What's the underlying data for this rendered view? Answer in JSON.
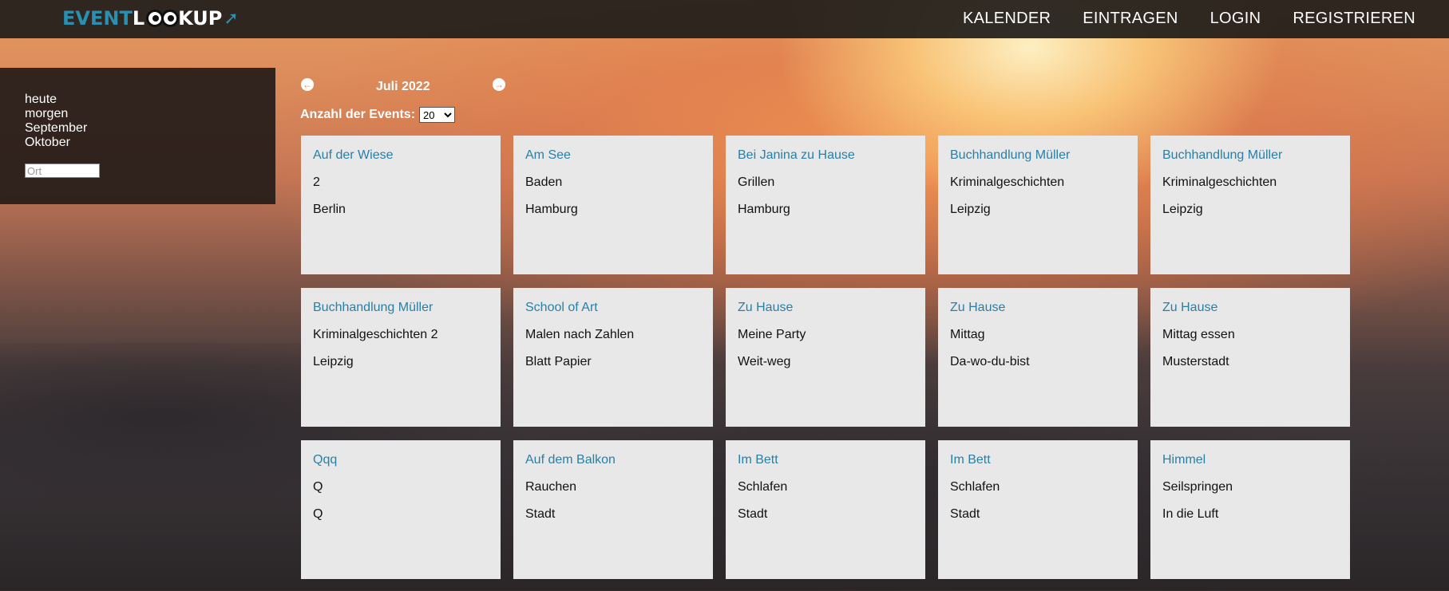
{
  "header": {
    "logo_text": "EVENTLOOKUP",
    "nav": [
      "KALENDER",
      "EINTRAGEN",
      "LOGIN",
      "REGISTRIEREN"
    ]
  },
  "sidebar": {
    "links": [
      "heute",
      "morgen",
      "September",
      "Oktober"
    ],
    "ort_placeholder": "Ort"
  },
  "calendar": {
    "month": "Juli 2022",
    "count_label": "Anzahl der Events:",
    "count_value": "20"
  },
  "events": [
    {
      "place": "Auf der Wiese",
      "title": "2",
      "city": "Berlin"
    },
    {
      "place": "Am See",
      "title": "Baden",
      "city": "Hamburg"
    },
    {
      "place": "Bei Janina zu Hause",
      "title": "Grillen",
      "city": "Hamburg"
    },
    {
      "place": "Buchhandlung Müller",
      "title": "Kriminalgeschichten",
      "city": "Leipzig"
    },
    {
      "place": "Buchhandlung Müller",
      "title": "Kriminalgeschichten",
      "city": "Leipzig"
    },
    {
      "place": "Buchhandlung Müller",
      "title": "Kriminalgeschichten 2",
      "city": "Leipzig"
    },
    {
      "place": "School of Art",
      "title": "Malen nach Zahlen",
      "city": "Blatt Papier"
    },
    {
      "place": "Zu Hause",
      "title": "Meine Party",
      "city": "Weit-weg"
    },
    {
      "place": "Zu Hause",
      "title": "Mittag",
      "city": "Da-wo-du-bist"
    },
    {
      "place": "Zu Hause",
      "title": "Mittag essen",
      "city": "Musterstadt"
    },
    {
      "place": "Qqq",
      "title": "Q",
      "city": "Q"
    },
    {
      "place": "Auf dem Balkon",
      "title": "Rauchen",
      "city": "Stadt"
    },
    {
      "place": "Im Bett",
      "title": "Schlafen",
      "city": "Stadt"
    },
    {
      "place": "Im Bett",
      "title": "Schlafen",
      "city": "Stadt"
    },
    {
      "place": "Himmel",
      "title": "Seilspringen",
      "city": "In die Luft"
    }
  ]
}
